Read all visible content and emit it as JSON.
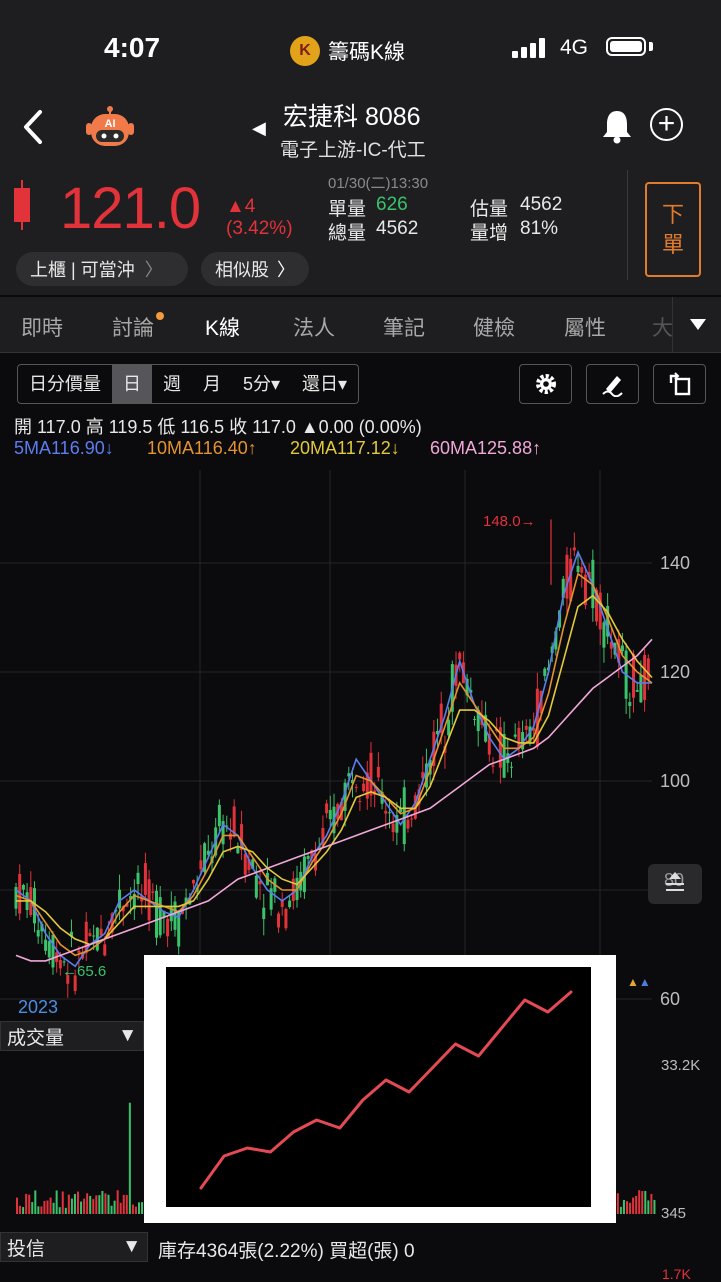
{
  "status_bar": {
    "time": "4:07",
    "app_name": "籌碼K線",
    "app_logo_letter": "K",
    "network": "4G"
  },
  "header": {
    "robot_label": "AI",
    "stock_name": "宏捷科 8086",
    "stock_category": "電子上游-IC-代工",
    "price": "121.0",
    "change": "▲4",
    "change_pct": "(3.42%)",
    "datetime": "01/30(二)13:30",
    "single_vol_label": "單量",
    "single_vol": "626",
    "est_vol_label": "估量",
    "est_vol": "4562",
    "total_vol_label": "總量",
    "total_vol": "4562",
    "vol_inc_label": "量增",
    "vol_inc": "81%",
    "order_button": [
      "下",
      "單"
    ],
    "tag_market": "上櫃 | 可當沖",
    "tag_similar": "相似股"
  },
  "tabs": [
    "即時",
    "討論",
    "K線",
    "法人",
    "筆記",
    "健檢",
    "屬性",
    "大"
  ],
  "active_tab": "K線",
  "chart_controls": {
    "segments": [
      "日分價量",
      "日",
      "週",
      "月",
      "5分▾",
      "還日▾"
    ],
    "selected": "日"
  },
  "ohlc_line": "開 117.0 高 119.5 低 116.5 收 117.0 ▲0.00 (0.00%)",
  "ma_labels": {
    "ma5": "5MA116.90↓",
    "ma10": "10MA116.40↑",
    "ma20": "20MA117.12↓",
    "ma60": "60MA125.88↑"
  },
  "colors": {
    "up": "#e2323a",
    "down": "#3ac36b",
    "ma5": "#5b7df0",
    "ma10": "#e3932f",
    "ma20": "#e2c93a",
    "ma60": "#f0a8d8",
    "accent_orange": "#e07c2c"
  },
  "annotations": {
    "high": "148.0→",
    "low": "←65.6",
    "year": "2023"
  },
  "volume_panel": {
    "selector": "成交量",
    "y_top": "33.2K",
    "y_bottom": "345"
  },
  "bottom_panel": {
    "selector": "投信",
    "info": "庫存4364張(2.22%)  買超(張) 0",
    "y_top": "1.7K"
  },
  "chart_data": {
    "type": "line",
    "title": "",
    "xlabel": "2023",
    "ylabel": "",
    "ylim": [
      58,
      150
    ],
    "yticks": [
      140,
      120,
      100,
      80,
      60
    ],
    "ytick_labels": [
      "140",
      "120",
      "100",
      "80",
      "60"
    ],
    "series": [
      {
        "name": "5MA116.90↓",
        "values": [
          80,
          78,
          72,
          68,
          66,
          70,
          72,
          78,
          80,
          78,
          76,
          75,
          80,
          86,
          92,
          90,
          84,
          80,
          78,
          80,
          86,
          90,
          96,
          104,
          100,
          96,
          92,
          96,
          104,
          112,
          122,
          114,
          108,
          104,
          106,
          110,
          120,
          134,
          142,
          136,
          128,
          120,
          118,
          118
        ]
      },
      {
        "name": "10MA116.40↑",
        "values": [
          79,
          78,
          74,
          70,
          68,
          69,
          71,
          76,
          79,
          78,
          77,
          76,
          79,
          84,
          90,
          90,
          86,
          82,
          80,
          80,
          85,
          89,
          94,
          101,
          100,
          97,
          94,
          95,
          102,
          110,
          118,
          114,
          110,
          106,
          106,
          108,
          116,
          128,
          138,
          136,
          130,
          123,
          120,
          118
        ]
      },
      {
        "name": "20MA117.12↓",
        "values": [
          78,
          78,
          76,
          73,
          71,
          70,
          71,
          74,
          77,
          77,
          77,
          77,
          78,
          82,
          87,
          88,
          87,
          84,
          82,
          81,
          84,
          87,
          91,
          97,
          98,
          97,
          95,
          95,
          99,
          106,
          113,
          113,
          111,
          108,
          107,
          107,
          112,
          122,
          132,
          134,
          131,
          126,
          122,
          119
        ]
      },
      {
        "name": "60MA125.88↑",
        "values": [
          68,
          67,
          67,
          68,
          69,
          70,
          71,
          72,
          73,
          74,
          75,
          76,
          77,
          78,
          80,
          82,
          83,
          84,
          85,
          86,
          87,
          88,
          89,
          90,
          91,
          92,
          93,
          94,
          95,
          97,
          99,
          101,
          103,
          104,
          105,
          106,
          108,
          111,
          114,
          117,
          119,
          121,
          123,
          126
        ]
      }
    ],
    "high_value": 148.0,
    "low_value": 65.6,
    "inset_trend": [
      0.02,
      0.18,
      0.22,
      0.2,
      0.3,
      0.36,
      0.32,
      0.46,
      0.56,
      0.5,
      0.62,
      0.74,
      0.68,
      0.82,
      0.96,
      0.9,
      1.0
    ]
  }
}
